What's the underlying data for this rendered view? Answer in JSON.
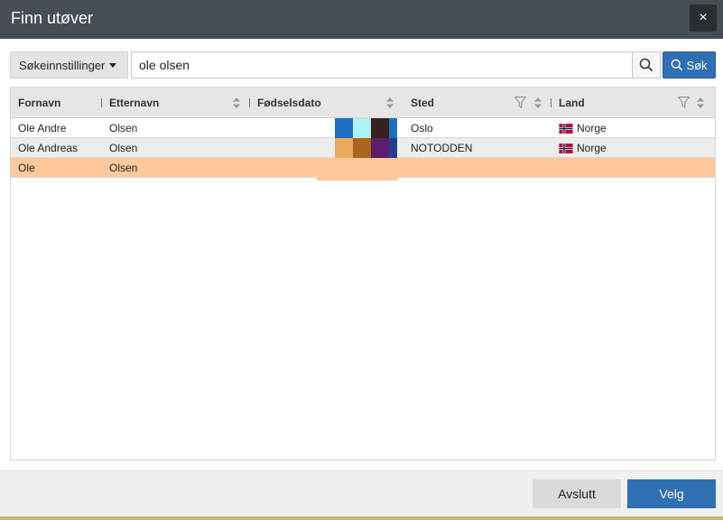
{
  "dialog": {
    "title": "Finn utøver",
    "close_label": "×"
  },
  "toolbar": {
    "settings_label": "Søkeinnstillinger",
    "search_value": "ole olsen",
    "search_button_label": "Søk"
  },
  "grid": {
    "columns": [
      {
        "label": "Fornavn"
      },
      {
        "label": "Etternavn"
      },
      {
        "label": "Fødselsdato"
      },
      {
        "label": "Sted"
      },
      {
        "label": "Land"
      }
    ],
    "rows": [
      {
        "fornavn": "Ole Andre",
        "etternavn": "Olsen",
        "sted": "Oslo",
        "land": "Norge",
        "pixels": [
          "#1f6fc0",
          "#aef4f4",
          "#3a1f1f",
          "#1f6fc0"
        ]
      },
      {
        "fornavn": "Ole Andreas",
        "etternavn": "Olsen",
        "sted": "NOTODDEN",
        "land": "Norge",
        "pixels": [
          "#e9a95e",
          "#a8661f",
          "#5c1d6b",
          "#263f8c"
        ]
      },
      {
        "fornavn": "Ole",
        "etternavn": "Olsen",
        "sted": "",
        "land": "",
        "pixels": [
          "#ffc89d",
          "#ffc89d",
          "#ffc89d",
          "#ffc89d"
        ]
      }
    ]
  },
  "footer": {
    "avslutt_label": "Avslutt",
    "velg_label": "Velg"
  },
  "colors": {
    "titlebar": "#474d55",
    "primary": "#2f6fb3",
    "selected_row": "#ffc89d"
  }
}
